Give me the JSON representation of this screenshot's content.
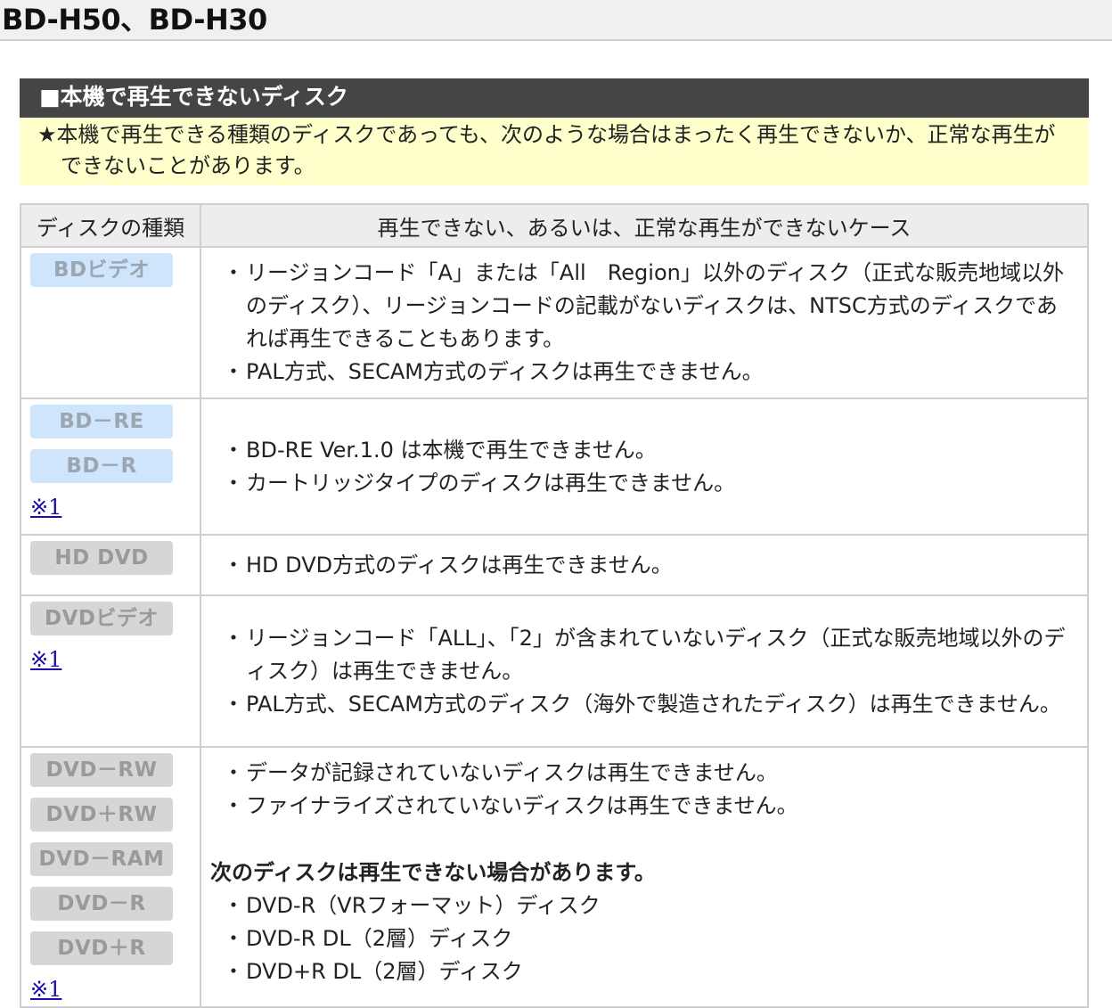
{
  "page": {
    "title": "BD-H50、BD-H30"
  },
  "section": {
    "heading": "■本機で再生できないディスク",
    "note": "★本機で再生できる種類のディスクであっても、次のような場合はまったく再生できないか、正常な再生ができないことがあります。"
  },
  "table": {
    "headers": {
      "type": "ディスクの種類",
      "case": "再生できない、あるいは、正常な再生ができないケース"
    },
    "rows": [
      {
        "badges": [
          "BDビデオ"
        ],
        "badge_color": "#cfe5fb",
        "items": [
          "リージョンコード「A」または「All　Region」以外のディスク（正式な販売地域以外のディスク）、リージョンコードの記載がないディスクは、NTSC方式のディスクであれば再生できることもあります。",
          "PAL方式、SECAM方式のディスクは再生できません。"
        ]
      },
      {
        "badges": [
          "BD－RE",
          "BD－R"
        ],
        "badge_color": "#cfe5fb",
        "ref": "※1",
        "items": [
          "BD-RE Ver.1.0 は本機で再生できません。",
          "カートリッジタイプのディスクは再生できません。"
        ]
      },
      {
        "badges": [
          "HD DVD"
        ],
        "badge_color": "#d6d6d6",
        "items": [
          "HD DVD方式のディスクは再生できません。"
        ]
      },
      {
        "badges": [
          "DVDビデオ"
        ],
        "badge_color": "#d6d6d6",
        "ref": "※1",
        "items": [
          "リージョンコード「ALL」、「2」が含まれていないディスク（正式な販売地域以外のディスク）は再生できません。",
          "PAL方式、SECAM方式のディスク（海外で製造されたディスク）は再生できません。"
        ]
      },
      {
        "badges": [
          "DVD－RW",
          "DVD＋RW",
          "DVD－RAM",
          "DVD－R",
          "DVD＋R"
        ],
        "badge_color": "#d6d6d6",
        "ref": "※1",
        "items": [
          "データが記録されていないディスクは再生できません。",
          "ファイナライズされていないディスクは再生できません。"
        ],
        "subheading": "次のディスクは再生できない場合があります。",
        "subitems": [
          "DVD-R（VRフォーマット）ディスク",
          "DVD-R DL（2層）ディスク",
          "DVD+R DL（2層）ディスク"
        ]
      }
    ]
  }
}
